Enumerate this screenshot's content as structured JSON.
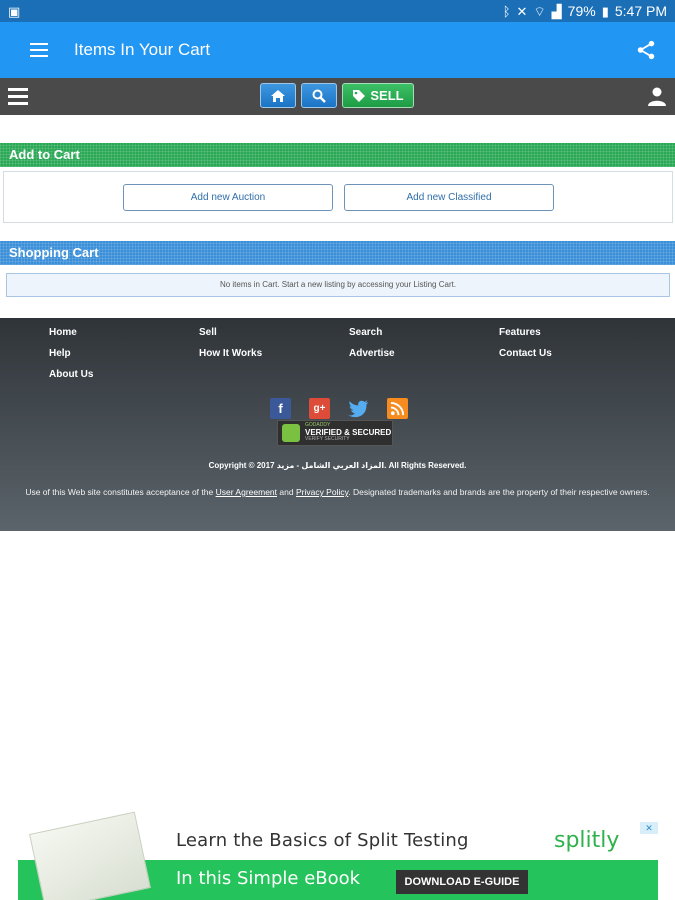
{
  "status_bar": {
    "battery": "79%",
    "time": "5:47 PM"
  },
  "app_bar": {
    "title": "Items In Your Cart"
  },
  "nav_bar": {
    "sell_label": "SELL"
  },
  "add_to_cart": {
    "header": "Add to Cart",
    "auction_button": "Add new Auction",
    "classified_button": "Add new Classified"
  },
  "shopping_cart": {
    "header": "Shopping Cart",
    "empty_message": "No items in Cart. Start a new listing by accessing your Listing Cart."
  },
  "footer": {
    "links": {
      "home": "Home",
      "sell": "Sell",
      "search": "Search",
      "features": "Features",
      "help": "Help",
      "how_it_works": "How It Works",
      "advertise": "Advertise",
      "contact_us": "Contact Us",
      "about_us": "About Us"
    },
    "seal_top": "GODADDY",
    "seal_main": "VERIFIED & SECURED",
    "seal_sub": "VERIFY SECURITY",
    "copyright": "Copyright © 2017 المزاد العربي الشامل - مزيد. All Rights Reserved.",
    "terms_prefix": "Use of this Web site constitutes acceptance of the",
    "user_agreement": "User Agreement",
    "and": "and",
    "privacy_policy": "Privacy Policy",
    "terms_suffix": ". Designated trademarks and brands are the property of their respective owners."
  },
  "ad": {
    "line1": "Learn the Basics of Split Testing",
    "line2": "In this Simple eBook",
    "cta": "DOWNLOAD E-GUIDE",
    "brand": "splitly"
  },
  "colors": {
    "status_bar": "#1a6fb7",
    "app_bar": "#2196f3",
    "nav_bar": "#4a4a4a",
    "green_header": "#2aa855",
    "blue_header": "#3a8fd8",
    "ad_green": "#25c35b"
  }
}
